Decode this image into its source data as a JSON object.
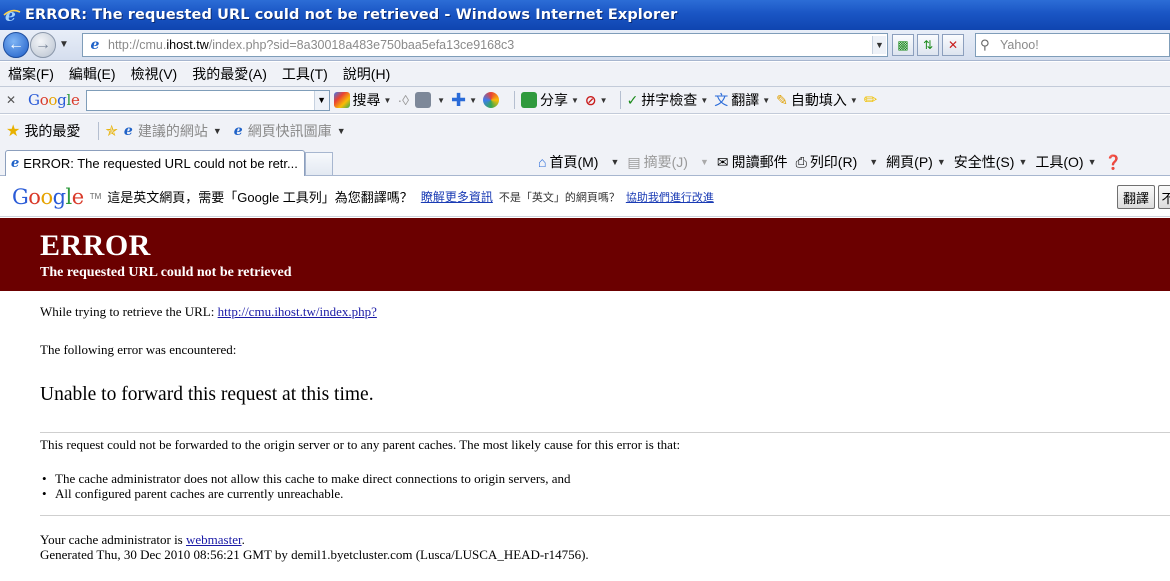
{
  "window": {
    "title": "ERROR: The requested URL could not be retrieved - Windows Internet Explorer"
  },
  "nav": {
    "url_prefix": "http://cmu.",
    "url_host": "ihost.tw",
    "url_suffix": "/index.php?sid=8a30018a483e750baa5efa13ce9168c3",
    "search_placeholder": "Yahoo!"
  },
  "menu": {
    "items": [
      "檔案(F)",
      "編輯(E)",
      "檢視(V)",
      "我的最愛(A)",
      "工具(T)",
      "說明(H)"
    ]
  },
  "google_toolbar": {
    "search": "搜尋",
    "share": "分享",
    "spellcheck": "拼字檢查",
    "translate": "翻譯",
    "autofill": "自動填入"
  },
  "favorites": {
    "label": "我的最愛",
    "suggested_sites": "建議的網站",
    "web_slice_gallery": "網頁快訊圖庫"
  },
  "tab": {
    "title": "ERROR: The requested URL could not be retr..."
  },
  "commands": {
    "home": "首頁(M)",
    "feeds": "摘要(J)",
    "read_mail": "閱讀郵件",
    "print": "列印(R)",
    "page": "網頁(P)",
    "safety": "安全性(S)",
    "tools": "工具(O)"
  },
  "translate_bar": {
    "question": "這是英文網頁，需要「Google 工具列」為您翻譯嗎？",
    "learn_more": "瞭解更多資訊",
    "not_english": "不是「英文」的網頁嗎？",
    "help_improve": "協助我們進行改進",
    "translate_button": "翻譯",
    "cut_button": "不"
  },
  "page": {
    "error_title": "ERROR",
    "error_subtitle": "The requested URL could not be retrieved",
    "retrieve_prefix": "While trying to retrieve the URL: ",
    "retrieve_url": "http://cmu.ihost.tw/index.php?",
    "encountered": "The following error was encountered:",
    "main_message": "Unable to forward this request at this time.",
    "explanation": "This request could not be forwarded to the origin server or to any parent caches. The most likely cause for this error is that:",
    "bullets": [
      "The cache administrator does not allow this cache to make direct connections to origin servers, and",
      "All configured parent caches are currently unreachable."
    ],
    "admin_prefix": "Your cache administrator is ",
    "admin_link": "webmaster",
    "admin_suffix": ".",
    "generated": "Generated Thu, 30 Dec 2010 08:56:21 GMT by demil1.byetcluster.com (Lusca/LUSCA_HEAD-r14756)."
  }
}
